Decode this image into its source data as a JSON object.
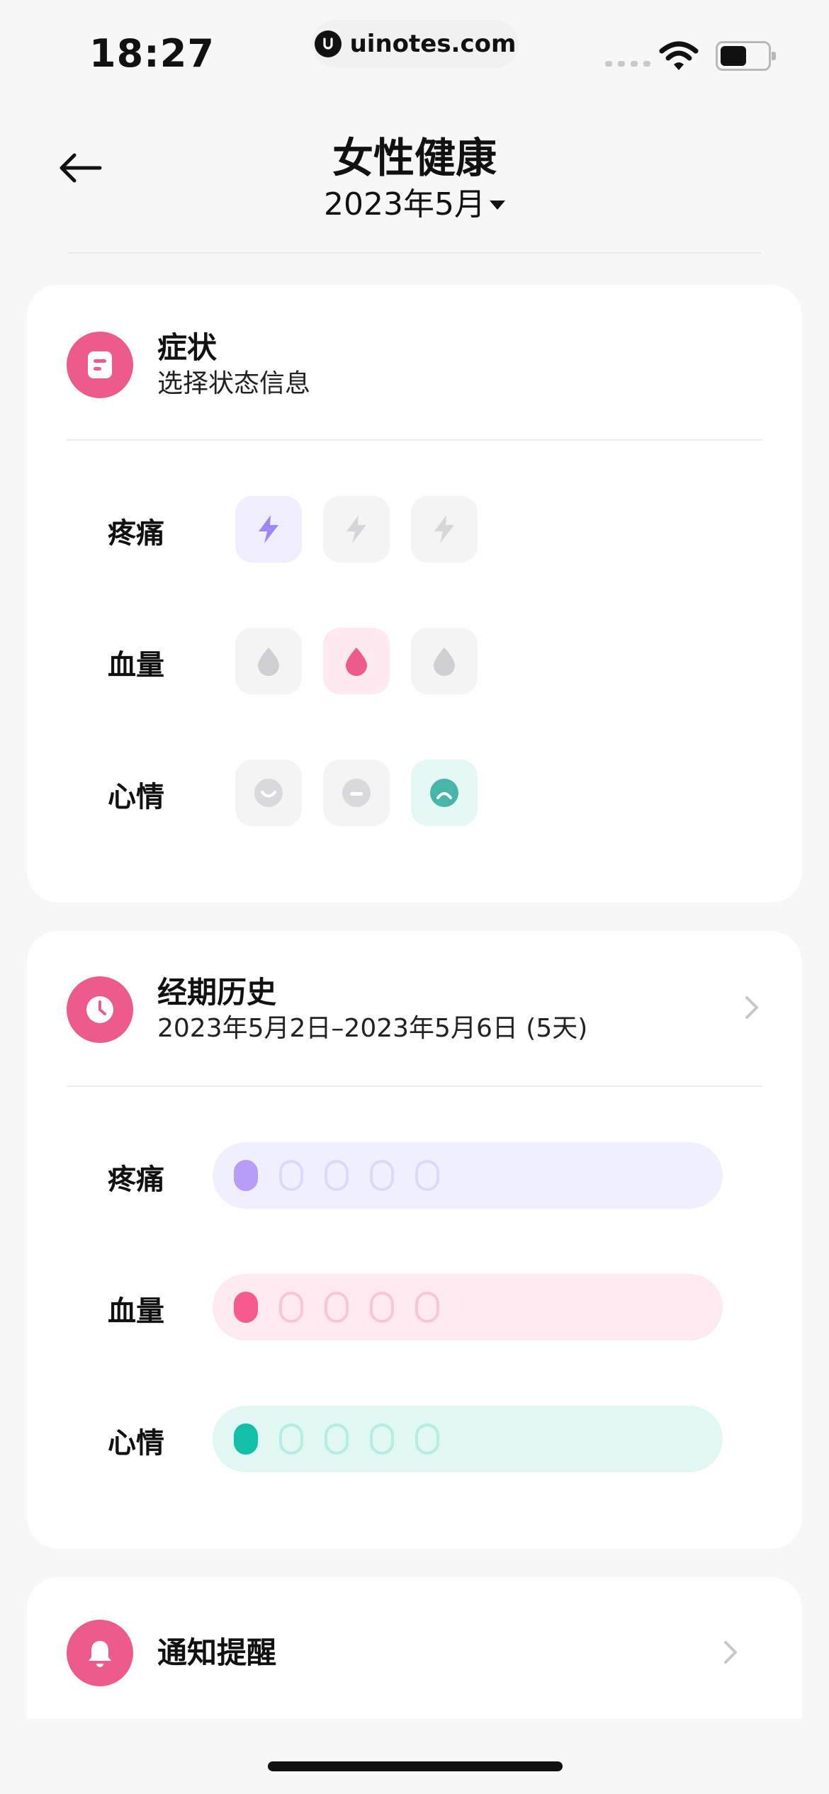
{
  "status_bar": {
    "time": "18:27",
    "watermark": "uinotes.com"
  },
  "header": {
    "title": "女性健康",
    "month": "2023年5月"
  },
  "symptoms_card": {
    "title": "症状",
    "subtitle": "选择状态信息",
    "rows": [
      {
        "label": "疼痛",
        "icon": "lightning-icon",
        "selected_index": 0,
        "accent": "#9f86f7",
        "accent_bg": "#f0eefe"
      },
      {
        "label": "血量",
        "icon": "droplet-icon",
        "selected_index": 1,
        "accent": "#ec5b8c",
        "accent_bg": "#fde9ef"
      },
      {
        "label": "心情",
        "icon": "face-icon",
        "selected_index": 2,
        "accent": "#48b5a8",
        "accent_bg": "#e5f8f4"
      }
    ]
  },
  "history_card": {
    "title": "经期历史",
    "subtitle": "2023年5月2日–2023年5月6日 (5天)",
    "rows": [
      {
        "label": "疼痛",
        "days": 5,
        "filled": 1,
        "color": "#b79cf8",
        "bg": "#f0effd",
        "outline": "#dcd9fb"
      },
      {
        "label": "血量",
        "days": 5,
        "filled": 1,
        "color": "#f75a8e",
        "bg": "#fde9f0",
        "outline": "#f9c6d6"
      },
      {
        "label": "心情",
        "days": 5,
        "filled": 1,
        "color": "#13bfa6",
        "bg": "#e0f7f2",
        "outline": "#b6ece2"
      }
    ]
  },
  "notification_card": {
    "title": "通知提醒"
  },
  "colors": {
    "brand_pink": "#ec5b8c",
    "background": "#f7f7f8"
  }
}
